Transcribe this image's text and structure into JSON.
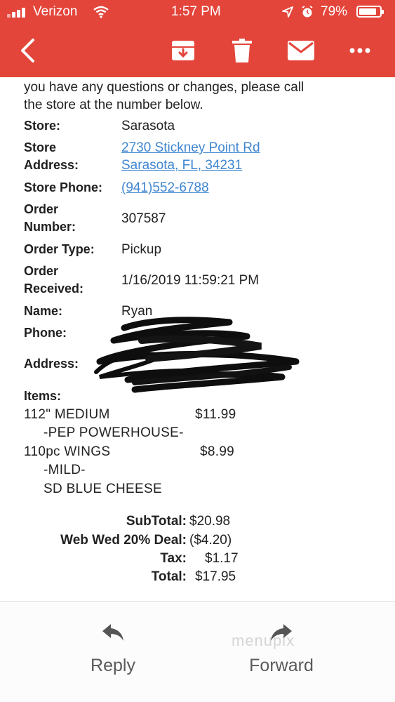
{
  "status_bar": {
    "carrier": "Verizon",
    "time": "1:57 PM",
    "battery": "79%",
    "battery_level": 0.79
  },
  "toolbar": {
    "back_icon": "chevron-left-icon",
    "archive_icon": "archive-icon",
    "delete_icon": "trash-icon",
    "mail_icon": "envelope-icon",
    "more_icon": "ellipsis-icon"
  },
  "email": {
    "intro_line1": "you have any questions or changes, please call",
    "intro_line2": "the store at the number below.",
    "fields": {
      "store_label": "Store:",
      "store_value": "Sarasota",
      "store_address_label_1": "Store",
      "store_address_label_2": "Address:",
      "store_address_line1": "2730 Stickney Point Rd",
      "store_address_line2": "Sarasota, FL, 34231",
      "store_phone_label": "Store Phone:",
      "store_phone_value": "(941)552-6788",
      "order_number_label_1": "Order",
      "order_number_label_2": "Number:",
      "order_number_value": "307587",
      "order_type_label": "Order Type:",
      "order_type_value": "Pickup",
      "order_received_label_1": "Order",
      "order_received_label_2": "Received:",
      "order_received_value": "1/16/2019 11:59:21 PM",
      "name_label": "Name:",
      "name_value": "Ryan",
      "phone_label": "Phone:",
      "address_label": "Address:"
    },
    "items_label": "Items:",
    "items": [
      {
        "line": "112\" MEDIUM",
        "price": "$11.99"
      },
      {
        "line": "-PEP POWERHOUSE-"
      },
      {
        "line": "110pc WINGS",
        "price": "$8.99"
      },
      {
        "line": "-MILD-"
      },
      {
        "line": "SD BLUE CHEESE"
      }
    ],
    "totals": [
      {
        "label": "SubTotal:",
        "value": "$20.98"
      },
      {
        "label": "Web Wed 20% Deal:",
        "value": "($4.20)"
      },
      {
        "label": "Tax:",
        "value": "$1.17"
      },
      {
        "label": "Total:",
        "value": "$17.95"
      }
    ]
  },
  "bottom_bar": {
    "reply_label": "Reply",
    "forward_label": "Forward",
    "watermark": "menupix"
  },
  "colors": {
    "header": "#e4453b",
    "link": "#3f86d1"
  }
}
